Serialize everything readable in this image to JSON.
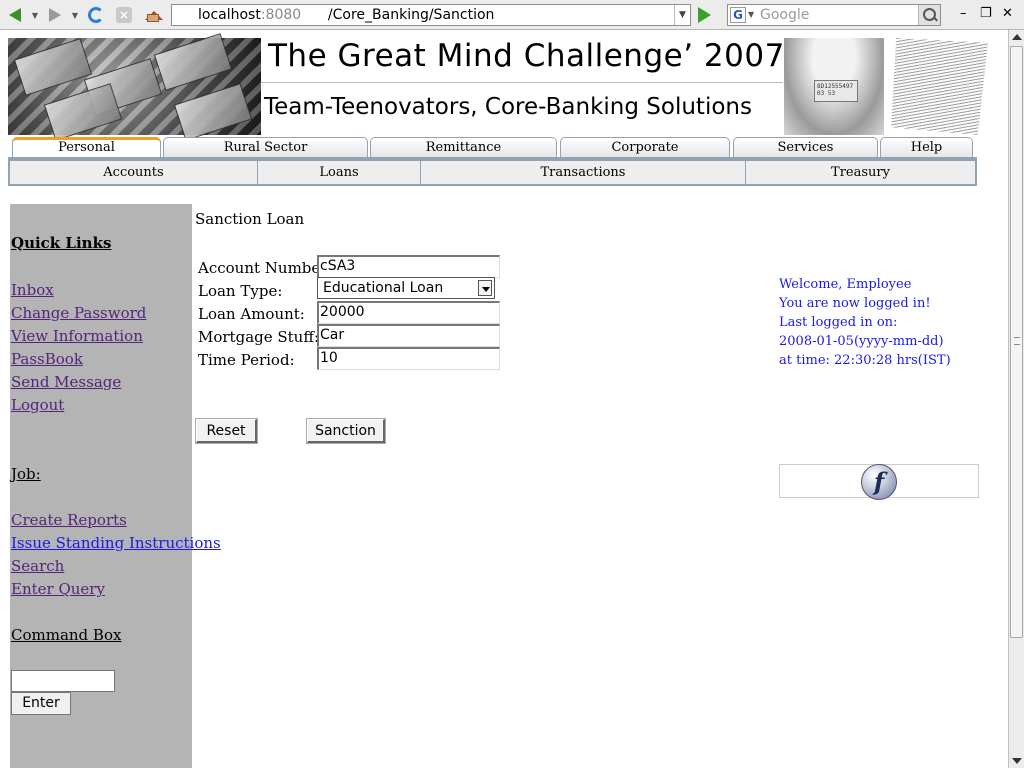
{
  "browser": {
    "url_host": "localhost",
    "url_port": ":8080",
    "url_path": "/Core_Banking/Sanction",
    "search_placeholder": "Google",
    "search_engine_glyph": "G",
    "window_controls": [
      "–",
      "❐",
      "✕"
    ]
  },
  "banner": {
    "title": "The Great Mind Challenge’ 2007",
    "subtitle": "Team-Teenovators, Core-Banking Solutions",
    "band_text": "8D12555497\n03\n53"
  },
  "tabs": [
    {
      "label": "Personal",
      "active": true
    },
    {
      "label": "Rural Sector",
      "active": false
    },
    {
      "label": "Remittance",
      "active": false
    },
    {
      "label": "Corporate",
      "active": false
    },
    {
      "label": "Services",
      "active": false
    },
    {
      "label": "Help",
      "active": false
    }
  ],
  "subnav": [
    "Accounts",
    "Loans",
    "Transactions",
    "Treasury"
  ],
  "sidebar": {
    "quick_links_heading": "Quick Links",
    "quick_links": [
      "Inbox",
      "Change Password",
      "View Information",
      "PassBook",
      "Send Message",
      "Logout"
    ],
    "job_heading": "Job:",
    "job_links": [
      "Create Reports",
      "Issue Standing Instructions",
      "Search",
      "Enter Query"
    ],
    "command_box_heading": "Command Box",
    "command_value": "",
    "enter_label": "Enter"
  },
  "form": {
    "title": "Sanction Loan",
    "account_number_label": "Account Number:",
    "account_number": "cSA3",
    "loan_type_label": "Loan Type:",
    "loan_type": "Educational Loan",
    "loan_amount_label": "Loan Amount:",
    "loan_amount": "20000",
    "mortgage_label": "Mortgage Stuff:",
    "mortgage": "Car",
    "time_period_label": "Time Period:",
    "time_period": "10",
    "reset_label": "Reset",
    "sanction_label": "Sanction"
  },
  "welcome": {
    "line1": "Welcome, Employee",
    "line2": "You are now logged in!",
    "line3": "Last logged in on:",
    "line4": "2008-01-05(yyyy-mm-dd)",
    "line5": "at time: 22:30:28 hrs(IST)"
  },
  "flash_glyph": "f",
  "colors": {
    "sidebar_bg": "#b4b4b4",
    "visited_link": "#55237a",
    "link": "#1a1ae6",
    "tab_accent": "#f0a020",
    "tab_border": "#8fa3b5"
  }
}
